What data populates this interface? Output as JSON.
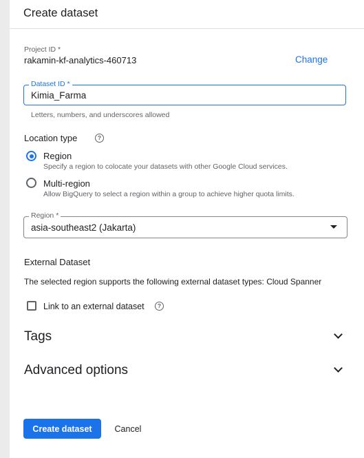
{
  "header": {
    "title": "Create dataset"
  },
  "project": {
    "label": "Project ID *",
    "value": "rakamin-kf-analytics-460713",
    "change_label": "Change"
  },
  "dataset": {
    "label": "Dataset ID *",
    "value": "Kimia_Farma",
    "hint": "Letters, numbers, and underscores allowed"
  },
  "location": {
    "title": "Location type",
    "help_glyph": "?",
    "options": [
      {
        "label": "Region",
        "description": "Specify a region to colocate your datasets with other Google Cloud services.",
        "selected": true
      },
      {
        "label": "Multi-region",
        "description": "Allow BigQuery to select a region within a group to achieve higher quota limits.",
        "selected": false
      }
    ]
  },
  "region": {
    "label": "Region *",
    "value": "asia-southeast2 (Jakarta)"
  },
  "external": {
    "title": "External Dataset",
    "description": "The selected region supports the following external dataset types: Cloud Spanner",
    "checkbox_label": "Link to an external dataset",
    "checked": false
  },
  "sections": {
    "tags": "Tags",
    "advanced": "Advanced options"
  },
  "actions": {
    "create_label": "Create dataset",
    "cancel_label": "Cancel"
  },
  "colors": {
    "accent": "#1a73e8",
    "text": "#202124",
    "secondary_text": "#5f6368",
    "spellcheck": "#d93025"
  },
  "icons": {
    "help": "help-circle-icon",
    "dropdown": "arrow-drop-down-icon",
    "expand": "chevron-down-icon"
  }
}
